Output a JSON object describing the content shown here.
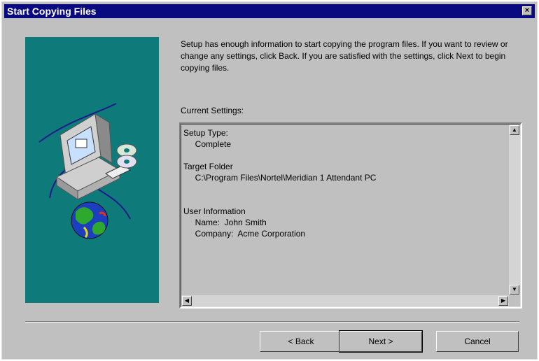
{
  "window": {
    "title": "Start Copying Files",
    "close_glyph": "×"
  },
  "intro_text": "Setup has enough information to start copying the program files.  If you want to review or change any settings, click Back.  If you are satisfied with the settings, click Next to begin copying files.",
  "current_settings_label": "Current Settings:",
  "settings": {
    "text": "Setup Type:\n     Complete\n\nTarget Folder\n     C:\\Program Files\\Nortel\\Meridian 1 Attendant PC\n\n\nUser Information\n     Name:  John Smith\n     Company:  Acme Corporation"
  },
  "scroll": {
    "up": "▲",
    "down": "▼",
    "left": "◀",
    "right": "▶"
  },
  "buttons": {
    "back": "< Back",
    "next": "Next >",
    "cancel": "Cancel"
  },
  "colors": {
    "titlebar": "#0a0a80",
    "panel": "#0f7a7a",
    "face": "#c0c0c0"
  },
  "icons": [
    "computer-icon",
    "cd-icon",
    "globe-icon"
  ]
}
